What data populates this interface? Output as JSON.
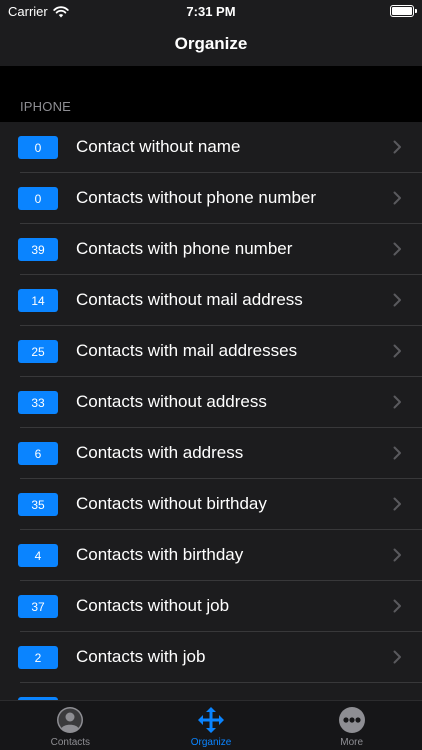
{
  "status_bar": {
    "carrier": "Carrier",
    "time": "7:31 PM"
  },
  "nav": {
    "title": "Organize"
  },
  "section": {
    "header": "IPHONE"
  },
  "rows": [
    {
      "count": "0",
      "label": "Contact without name"
    },
    {
      "count": "0",
      "label": "Contacts without phone number"
    },
    {
      "count": "39",
      "label": "Contacts with phone number"
    },
    {
      "count": "14",
      "label": "Contacts without mail address"
    },
    {
      "count": "25",
      "label": "Contacts with mail addresses"
    },
    {
      "count": "33",
      "label": "Contacts without address"
    },
    {
      "count": "6",
      "label": "Contacts with address"
    },
    {
      "count": "35",
      "label": "Contacts without birthday"
    },
    {
      "count": "4",
      "label": "Contacts with birthday"
    },
    {
      "count": "37",
      "label": "Contacts without job"
    },
    {
      "count": "2",
      "label": "Contacts with job"
    }
  ],
  "tabs": [
    {
      "label": "Contacts",
      "icon": "person-icon"
    },
    {
      "label": "Organize",
      "icon": "move-arrows-icon"
    },
    {
      "label": "More",
      "icon": "more-dots-icon"
    }
  ],
  "colors": {
    "accent": "#0a84ff",
    "background": "#000000",
    "cell": "#1c1c1e"
  }
}
